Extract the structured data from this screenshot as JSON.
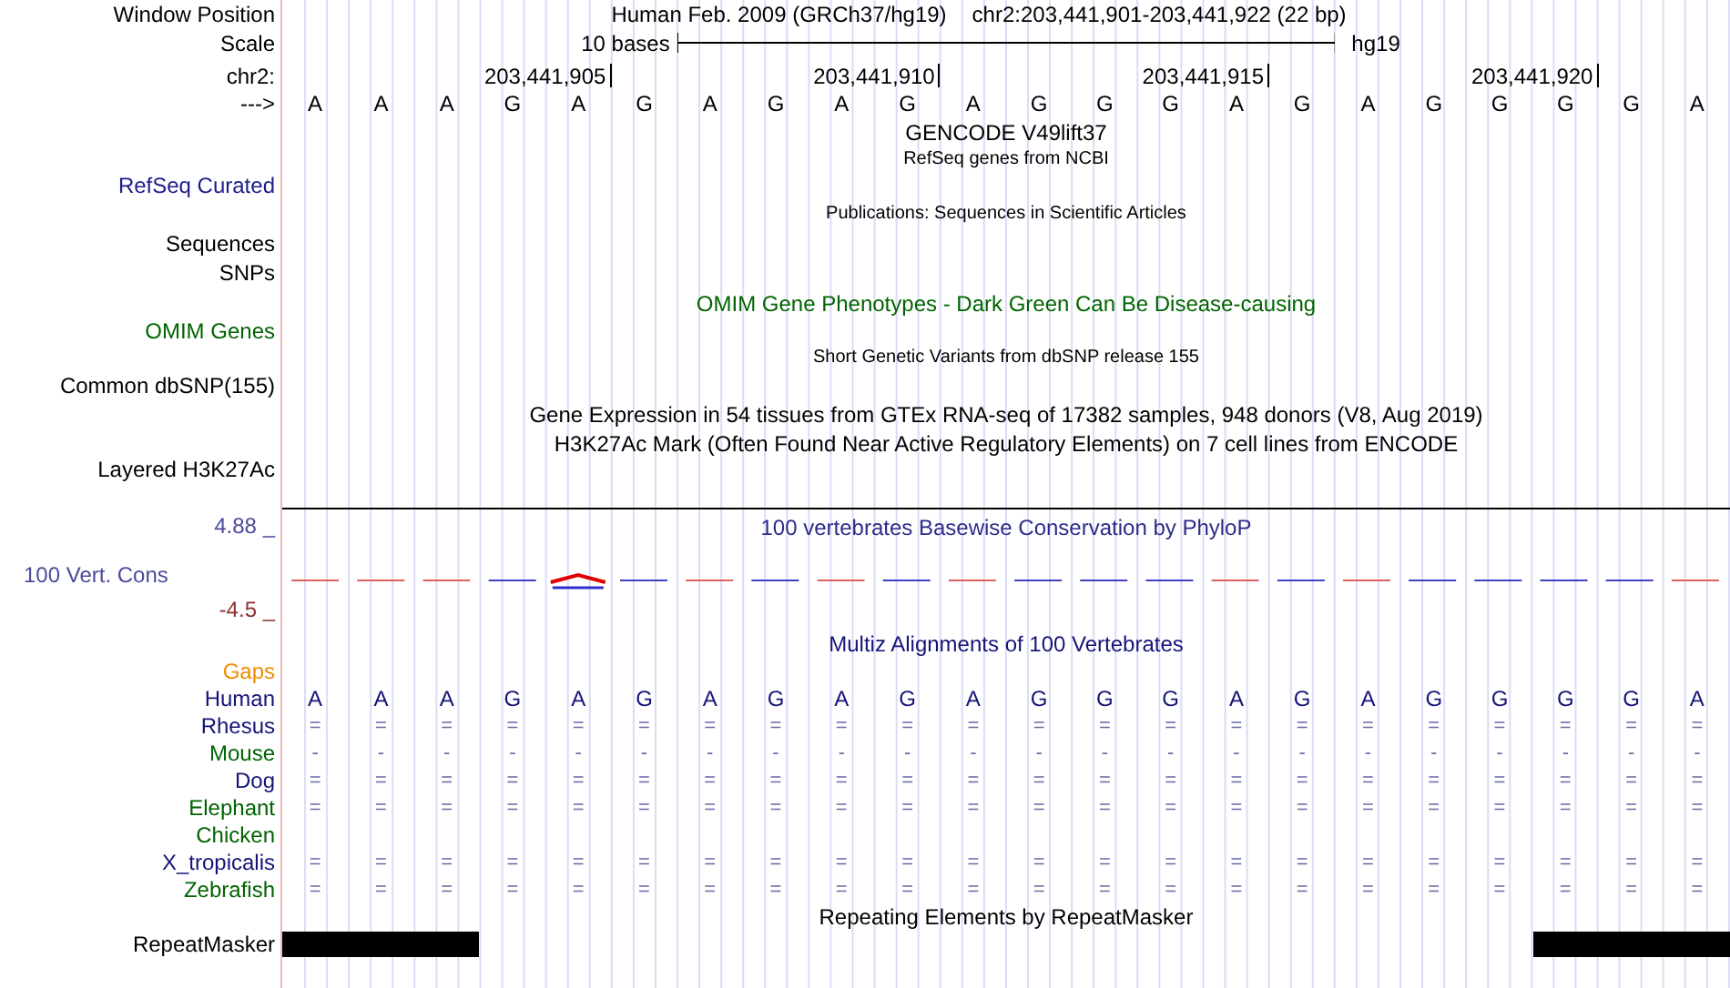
{
  "header": {
    "label": "Window Position",
    "title": "Human Feb. 2009 (GRCh37/hg19)",
    "position": "chr2:203,441,901-203,441,922 (22 bp)"
  },
  "scale": {
    "label": "Scale",
    "length": "10 bases",
    "assembly": "hg19"
  },
  "ruler": {
    "label": "chr2:",
    "ticks": [
      "203,441,905",
      "203,441,910",
      "203,441,915",
      "203,441,920"
    ]
  },
  "sequence": {
    "label": "--->",
    "bases": [
      "A",
      "A",
      "A",
      "G",
      "A",
      "G",
      "A",
      "G",
      "A",
      "G",
      "A",
      "G",
      "G",
      "G",
      "A",
      "G",
      "A",
      "G",
      "G",
      "G",
      "G",
      "A"
    ]
  },
  "tracks": [
    {
      "kind": "title",
      "text": "GENCODE V49lift37",
      "color": "#000000"
    },
    {
      "kind": "note",
      "text": "RefSeq genes from NCBI",
      "color": "#000000"
    },
    {
      "kind": "label",
      "text": "RefSeq Curated",
      "color": "#1c1c8c"
    },
    {
      "kind": "note",
      "text": "Publications: Sequences in Scientific Articles",
      "color": "#000000"
    },
    {
      "kind": "label",
      "text": "Sequences",
      "color": "#000000"
    },
    {
      "kind": "label",
      "text": "SNPs",
      "color": "#000000"
    },
    {
      "kind": "title",
      "text": "OMIM Gene Phenotypes - Dark Green Can Be Disease-causing",
      "color": "#006400"
    },
    {
      "kind": "label",
      "text": "OMIM Genes",
      "color": "#006400"
    },
    {
      "kind": "note",
      "text": "Short Genetic Variants from dbSNP release 155",
      "color": "#000000"
    },
    {
      "kind": "label",
      "text": "Common dbSNP(155)",
      "color": "#000000"
    },
    {
      "kind": "title",
      "text": "Gene Expression in 54 tissues from GTEx RNA-seq of 17382 samples, 948 donors (V8, Aug 2019)",
      "color": "#000000"
    },
    {
      "kind": "title",
      "text": "H3K27Ac Mark (Often Found Near Active Regulatory Elements) on 7 cell lines from ENCODE",
      "color": "#000000"
    },
    {
      "kind": "label",
      "text": "Layered H3K27Ac",
      "color": "#000000"
    }
  ],
  "conservation": {
    "title": "100 vertebrates Basewise Conservation by PhyloP",
    "label": "100 Vert. Cons",
    "max": "4.88 _",
    "min": "-4.5 _"
  },
  "multiz": {
    "title": "Multiz Alignments of 100 Vertebrates",
    "gaps_label": "Gaps",
    "species": [
      {
        "name": "Human",
        "color": "#14147a",
        "cells": [
          "A",
          "A",
          "A",
          "G",
          "A",
          "G",
          "A",
          "G",
          "A",
          "G",
          "A",
          "G",
          "G",
          "G",
          "A",
          "G",
          "A",
          "G",
          "G",
          "G",
          "G",
          "A"
        ]
      },
      {
        "name": "Rhesus",
        "color": "#14147a",
        "cells": [
          "=",
          "=",
          "=",
          "=",
          "=",
          "=",
          "=",
          "=",
          "=",
          "=",
          "=",
          "=",
          "=",
          "=",
          "=",
          "=",
          "=",
          "=",
          "=",
          "=",
          "=",
          "="
        ]
      },
      {
        "name": "Mouse",
        "color": "#006400",
        "cells": [
          "-",
          "-",
          "-",
          "-",
          "-",
          "-",
          "-",
          "-",
          "-",
          "-",
          "-",
          "-",
          "-",
          "-",
          "-",
          "-",
          "-",
          "-",
          "-",
          "-",
          "-",
          "-"
        ]
      },
      {
        "name": "Dog",
        "color": "#14147a",
        "cells": [
          "=",
          "=",
          "=",
          "=",
          "=",
          "=",
          "=",
          "=",
          "=",
          "=",
          "=",
          "=",
          "=",
          "=",
          "=",
          "=",
          "=",
          "=",
          "=",
          "=",
          "=",
          "="
        ]
      },
      {
        "name": "Elephant",
        "color": "#006400",
        "cells": [
          "=",
          "=",
          "=",
          "=",
          "=",
          "=",
          "=",
          "=",
          "=",
          "=",
          "=",
          "=",
          "=",
          "=",
          "=",
          "=",
          "=",
          "=",
          "=",
          "=",
          "=",
          "="
        ]
      },
      {
        "name": "Chicken",
        "color": "#006400"
      },
      {
        "name": "X_tropicalis",
        "color": "#14147a",
        "cells": [
          "=",
          "=",
          "=",
          "=",
          "=",
          "=",
          "=",
          "=",
          "=",
          "=",
          "=",
          "=",
          "=",
          "=",
          "=",
          "=",
          "=",
          "=",
          "=",
          "=",
          "=",
          "="
        ]
      },
      {
        "name": "Zebrafish",
        "color": "#006400",
        "cells": [
          "=",
          "=",
          "=",
          "=",
          "=",
          "=",
          "=",
          "=",
          "=",
          "=",
          "=",
          "=",
          "=",
          "=",
          "=",
          "=",
          "=",
          "=",
          "=",
          "=",
          "=",
          "="
        ]
      }
    ]
  },
  "repeats": {
    "title": "Repeating Elements by RepeatMasker",
    "label": "RepeatMasker"
  }
}
